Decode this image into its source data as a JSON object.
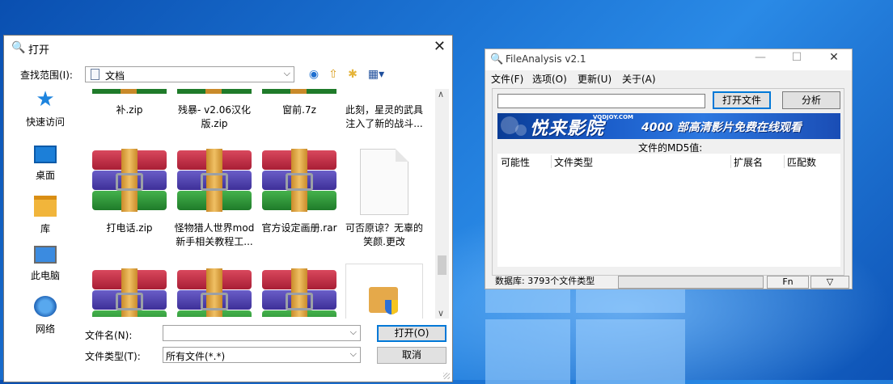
{
  "open_dialog": {
    "title": "打开",
    "lookin_label": "查找范围(I):",
    "lookin_value": "文档",
    "places": [
      {
        "label": "快速访问",
        "icon": "star-icon"
      },
      {
        "label": "桌面",
        "icon": "desktop-icon"
      },
      {
        "label": "库",
        "icon": "library-icon"
      },
      {
        "label": "此电脑",
        "icon": "computer-icon"
      },
      {
        "label": "网络",
        "icon": "network-icon"
      }
    ],
    "top_row": [
      "补.zip",
      "残暴- v2.06汉化版.zip",
      "窗前.7z",
      "此刻，星灵的武具注入了新的战斗..."
    ],
    "mid_row": [
      "打电话.zip",
      "怪物猎人世界mod新手相关教程工...",
      "官方设定画册.rar",
      "可否原谅？无辜的笑颜.更改"
    ],
    "filename_label": "文件名(N):",
    "filename_value": "",
    "filetype_label": "文件类型(T):",
    "filetype_value": "所有文件(*.*)",
    "open_button": "打开(O)",
    "cancel_button": "取消"
  },
  "fileanalysis": {
    "title": "FileAnalysis v2.1",
    "menu": [
      "文件(F)",
      "选项(O)",
      "更新(U)",
      "关于(A)"
    ],
    "path_value": "",
    "open_file_button": "打开文件",
    "analyze_button": "分析",
    "banner_logo": "悦来影院",
    "banner_site": "VODJOY.COM",
    "banner_slogan": "4000 部高清影片免费在线观看",
    "md5_label": "文件的MD5值:",
    "columns": [
      "可能性",
      "文件类型",
      "扩展名",
      "匹配数"
    ],
    "status_db": "数据库: 3793个文件类型",
    "status_fn": "Fn",
    "status_arrow": "▽"
  },
  "colors": {
    "accent": "#0078d7",
    "desktop_blue": "#1d76d6"
  }
}
